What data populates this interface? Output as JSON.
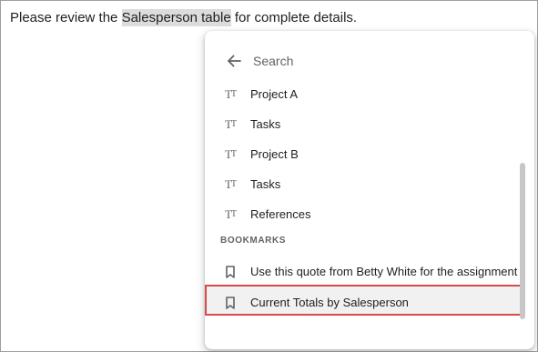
{
  "document": {
    "text_before": "Please review the ",
    "highlighted": "Salesperson table",
    "text_after": " for complete details."
  },
  "popup": {
    "search_placeholder": "Search",
    "headings": [
      {
        "label": "Project A",
        "icon": "heading-text-icon"
      },
      {
        "label": "Tasks",
        "icon": "heading-text-icon"
      },
      {
        "label": "Project B",
        "icon": "heading-text-icon"
      },
      {
        "label": "Tasks",
        "icon": "heading-text-icon"
      },
      {
        "label": "References",
        "icon": "heading-text-icon"
      }
    ],
    "bookmarks_heading": "BOOKMARKS",
    "bookmarks": [
      {
        "label": "Use this quote from Betty White for the assignment",
        "icon": "bookmark-icon"
      },
      {
        "label": "Current Totals by Salesperson",
        "icon": "bookmark-icon",
        "highlighted": true
      }
    ]
  },
  "colors": {
    "highlight_outline": "#d94a4a",
    "icon_gray": "#5f6368",
    "text": "#202124"
  }
}
